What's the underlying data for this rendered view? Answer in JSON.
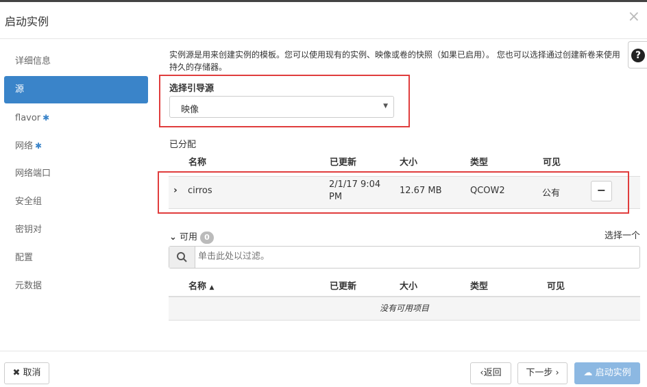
{
  "header": {
    "title": "启动实例",
    "close_glyph": "×"
  },
  "sidebar": {
    "items": [
      {
        "label": "详细信息",
        "required": false
      },
      {
        "label": "源",
        "required": false
      },
      {
        "label": "flavor",
        "required": true
      },
      {
        "label": "网络",
        "required": true
      },
      {
        "label": "网络端口",
        "required": false
      },
      {
        "label": "安全组",
        "required": false
      },
      {
        "label": "密钥对",
        "required": false
      },
      {
        "label": "配置",
        "required": false
      },
      {
        "label": "元数据",
        "required": false
      }
    ],
    "active_index": 1,
    "required_glyph": "✱"
  },
  "help": {
    "glyph": "?"
  },
  "description": "实例源是用来创建实例的模板。您可以使用现有的实例、映像或卷的快照（如果已启用）。 您也可以选择通过创建新卷来使用持久的存储器。",
  "boot_source": {
    "label": "选择引导源",
    "selected": "映像"
  },
  "allocated": {
    "label": "已分配",
    "columns": [
      "名称",
      "已更新",
      "大小",
      "类型",
      "可见"
    ],
    "rows": [
      {
        "name": "cirros",
        "updated": "2/1/17 9:04 PM",
        "size": "12.67 MB",
        "type": "QCOW2",
        "visibility": "公有"
      }
    ],
    "remove_glyph": "−"
  },
  "available": {
    "label": "可用",
    "count": "0",
    "select_one": "选择一个",
    "search_placeholder": "单击此处以过滤。",
    "columns": [
      "名称",
      "已更新",
      "大小",
      "类型",
      "可见"
    ],
    "empty_text": "没有可用项目"
  },
  "footer": {
    "cancel": "取消",
    "back": "返回",
    "next": "下一步",
    "launch": "启动实例"
  },
  "colors": {
    "accent": "#3a84c9",
    "highlight_box": "#e03c3c",
    "launch_button": "#8cb8e2"
  }
}
